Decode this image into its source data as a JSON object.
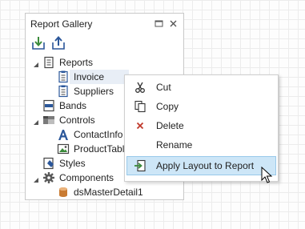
{
  "panel": {
    "title": "Report Gallery",
    "header_buttons": {
      "maximize_icon": "maximize-icon",
      "close_icon": "close-icon"
    },
    "toolbar": {
      "import_icon": "import-icon",
      "export_icon": "export-icon"
    }
  },
  "tree": {
    "reports": {
      "label": "Reports",
      "expanded": true,
      "icon": "report-icon"
    },
    "invoice": {
      "label": "Invoice",
      "selected": true,
      "icon": "report-page-icon"
    },
    "suppliers": {
      "label": "Suppliers",
      "icon": "report-page-icon"
    },
    "bands": {
      "label": "Bands",
      "icon": "band-icon"
    },
    "controls": {
      "label": "Controls",
      "expanded": true,
      "icon": "controls-folder-icon"
    },
    "contactinfo": {
      "label": "ContactInfo",
      "icon": "label-control-icon"
    },
    "producttable": {
      "label": "ProductTable",
      "icon": "picture-control-icon"
    },
    "styles": {
      "label": "Styles",
      "icon": "styles-icon"
    },
    "components": {
      "label": "Components",
      "expanded": true,
      "icon": "gear-icon"
    },
    "dsmasterdetail1": {
      "label": "dsMasterDetail1",
      "icon": "database-icon"
    }
  },
  "context_menu": {
    "items": [
      {
        "label": "Cut",
        "icon": "scissors-icon"
      },
      {
        "label": "Copy",
        "icon": "copy-icon"
      },
      {
        "label": "Delete",
        "icon": "delete-x-icon"
      },
      {
        "label": "Rename",
        "icon": ""
      },
      {
        "label": "Apply Layout to Report",
        "icon": "apply-layout-icon",
        "highlighted": true
      }
    ]
  },
  "colors": {
    "selection_bg": "#e8eef6",
    "menu_hover_bg": "#cde6f7",
    "menu_hover_border": "#99c9ea",
    "delete_red": "#c0392b",
    "icon_blue": "#2b579a",
    "icon_green": "#3a8a3a"
  }
}
